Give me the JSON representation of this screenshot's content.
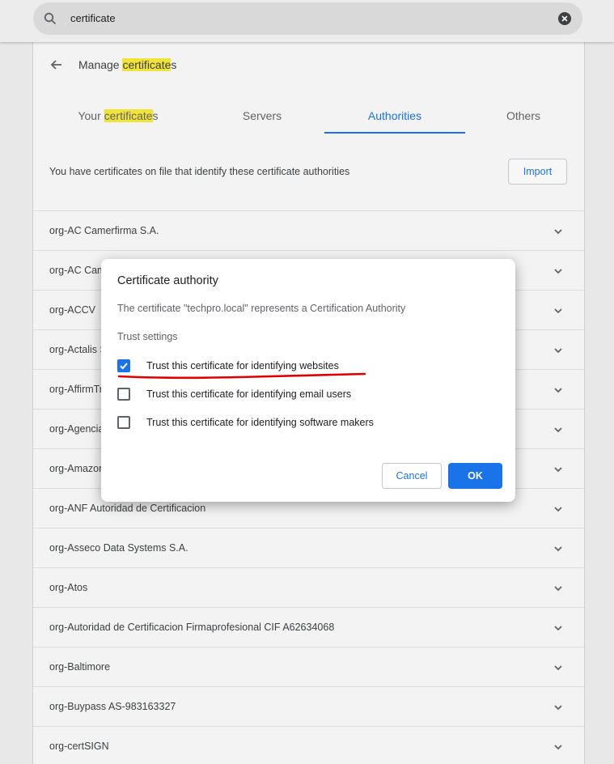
{
  "search": {
    "query": "certificate"
  },
  "header": {
    "title_prefix": "Manage ",
    "title_highlight": "certificate",
    "title_suffix": "s"
  },
  "tabs": [
    {
      "prefix": "Your ",
      "highlight": "certificate",
      "suffix": "s",
      "active": false
    },
    {
      "label": "Servers",
      "active": false
    },
    {
      "label": "Authorities",
      "active": true
    },
    {
      "label": "Others",
      "active": false
    }
  ],
  "info_text": "You have certificates on file that identify these certificate authorities",
  "import_label": "Import",
  "authorities": [
    "org-AC Camerfirma S.A.",
    "org-AC Camerfirma SA CIF A82743287",
    "org-ACCV",
    "org-Actalis S.p.A./03358520967",
    "org-AffirmTrust",
    "org-Agencia Catalana de Certificacio (NIF Q-0801176-I)",
    "org-Amazon",
    "org-ANF Autoridad de Certificacion",
    "org-Asseco Data Systems S.A.",
    "org-Atos",
    "org-Autoridad de Certificacion Firmaprofesional CIF A62634068",
    "org-Baltimore",
    "org-Buypass AS-983163327",
    "org-certSIGN"
  ],
  "dialog": {
    "title": "Certificate authority",
    "description": "The certificate \"techpro.local\" represents a Certification Authority",
    "subtitle": "Trust settings",
    "options": [
      {
        "label": "Trust this certificate for identifying websites",
        "checked": true
      },
      {
        "label": "Trust this certificate for identifying email users",
        "checked": false
      },
      {
        "label": "Trust this certificate for identifying software makers",
        "checked": false
      }
    ],
    "cancel_label": "Cancel",
    "ok_label": "OK"
  },
  "colors": {
    "accent": "#1a73e8",
    "highlight": "#f2e337",
    "annotation": "#e00000"
  }
}
